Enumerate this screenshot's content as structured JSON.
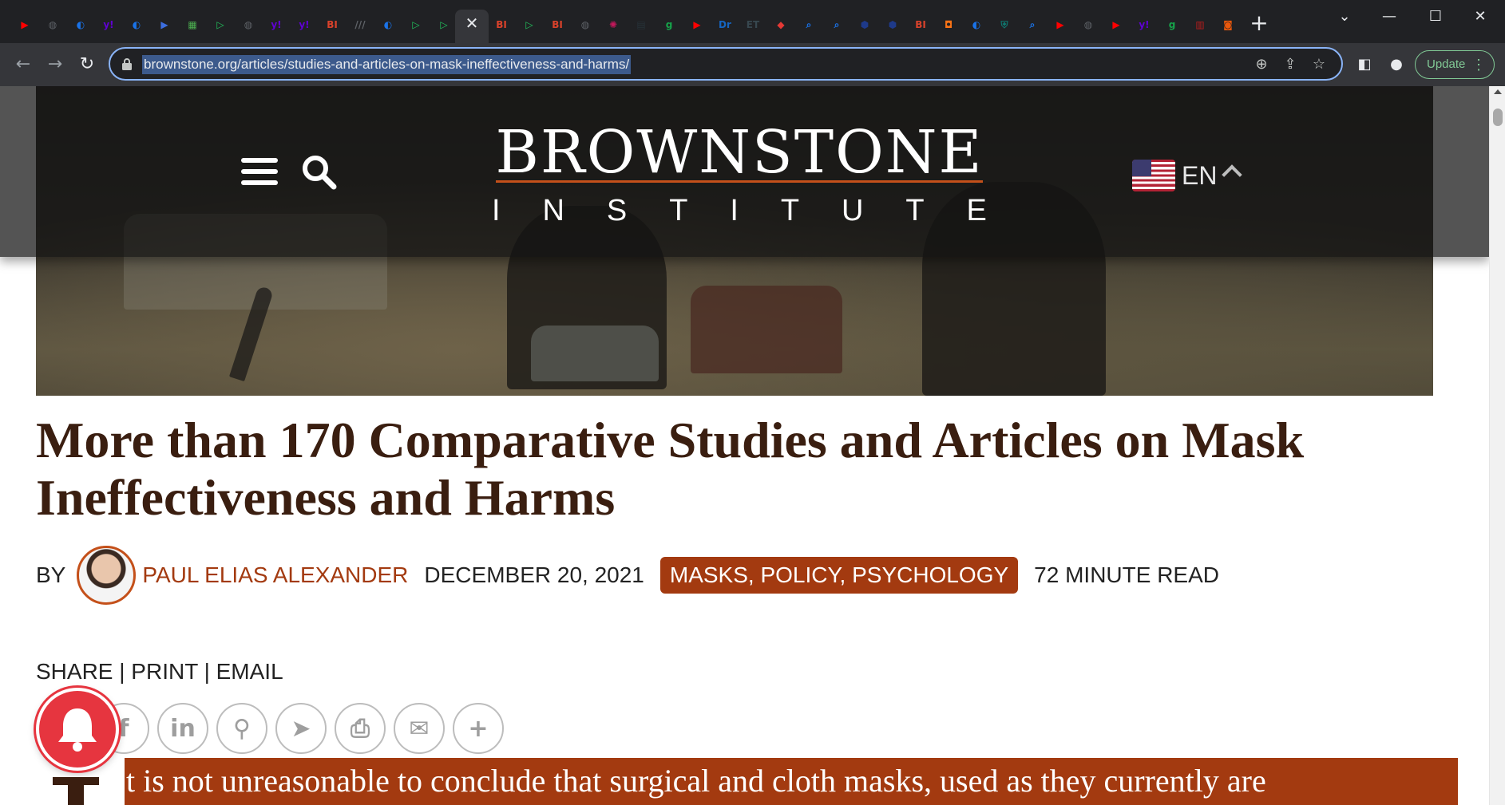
{
  "browser": {
    "url": "brownstone.org/articles/studies-and-articles-on-mask-ineffectiveness-and-harms/",
    "update_label": "Update",
    "tab_close_glyph": "✕",
    "new_tab_glyph": "+",
    "tab_icons": [
      {
        "glyph": "▶",
        "color": "#ff0000"
      },
      {
        "glyph": "◍",
        "color": "#5f6368"
      },
      {
        "glyph": "◐",
        "color": "#1a73e8"
      },
      {
        "glyph": "y!",
        "color": "#6001d2"
      },
      {
        "glyph": "◐",
        "color": "#1a73e8"
      },
      {
        "glyph": "▶",
        "color": "#3c6ee0"
      },
      {
        "glyph": "▦",
        "color": "#4caf50"
      },
      {
        "glyph": "▷",
        "color": "#22c55e"
      },
      {
        "glyph": "◍",
        "color": "#5f6368"
      },
      {
        "glyph": "y!",
        "color": "#6001d2"
      },
      {
        "glyph": "y!",
        "color": "#6001d2"
      },
      {
        "glyph": "BI",
        "color": "#d9422b"
      },
      {
        "glyph": "///",
        "color": "#5f6368"
      },
      {
        "glyph": "◐",
        "color": "#1a73e8"
      },
      {
        "glyph": "▷",
        "color": "#22c55e"
      },
      {
        "glyph": "▷",
        "color": "#22c55e"
      }
    ],
    "tab_icons_right": [
      {
        "glyph": "BI",
        "color": "#d9422b"
      },
      {
        "glyph": "▷",
        "color": "#22c55e"
      },
      {
        "glyph": "BI",
        "color": "#d9422b"
      },
      {
        "glyph": "◍",
        "color": "#5f6368"
      },
      {
        "glyph": "✺",
        "color": "#c2185b"
      },
      {
        "glyph": "▤",
        "color": "#263238"
      },
      {
        "glyph": "g",
        "color": "#16a34a"
      },
      {
        "glyph": "▶",
        "color": "#ff0000"
      },
      {
        "glyph": "Dr",
        "color": "#1565c0"
      },
      {
        "glyph": "ET",
        "color": "#37474f"
      },
      {
        "glyph": "◆",
        "color": "#e53935"
      },
      {
        "glyph": "⌕",
        "color": "#1a73e8"
      },
      {
        "glyph": "⌕",
        "color": "#1a73e8"
      },
      {
        "glyph": "⬢",
        "color": "#1e3a8a"
      },
      {
        "glyph": "⬢",
        "color": "#1e3a8a"
      },
      {
        "glyph": "BI",
        "color": "#d9422b"
      },
      {
        "glyph": "◘",
        "color": "#f97316"
      },
      {
        "glyph": "◐",
        "color": "#1a73e8"
      },
      {
        "glyph": "⛨",
        "color": "#0f766e"
      },
      {
        "glyph": "⌕",
        "color": "#1a73e8"
      },
      {
        "glyph": "▶",
        "color": "#ff0000"
      },
      {
        "glyph": "◍",
        "color": "#5f6368"
      },
      {
        "glyph": "▶",
        "color": "#ff0000"
      },
      {
        "glyph": "y!",
        "color": "#6001d2"
      },
      {
        "glyph": "g",
        "color": "#16a34a"
      },
      {
        "glyph": "▥",
        "color": "#b91c1c"
      },
      {
        "glyph": "◙",
        "color": "#ea580c"
      }
    ]
  },
  "site": {
    "logo_main": "BROWNSTONE",
    "logo_sub_letters": [
      "I",
      "N",
      "S",
      "T",
      "I",
      "T",
      "U",
      "T",
      "E"
    ],
    "language": "EN",
    "accent": "#a33a10"
  },
  "article": {
    "title": "More than 170 Comparative Studies and Articles on Mask Ineffectiveness and Harms",
    "by": "BY",
    "author": "PAUL ELIAS ALEXANDER",
    "date": "DECEMBER 20, 2021",
    "tags": "MASKS, POLICY, PSYCHOLOGY",
    "read_time": "72 MINUTE READ",
    "share_line": "SHARE | PRINT | EMAIL",
    "share_icons": [
      {
        "name": "facebook-icon",
        "glyph": "f"
      },
      {
        "name": "linkedin-icon",
        "glyph": "in"
      },
      {
        "name": "gettr-icon",
        "glyph": "⚲"
      },
      {
        "name": "telegram-icon",
        "glyph": "➤"
      },
      {
        "name": "print-icon",
        "glyph": "⎙"
      },
      {
        "name": "email-icon",
        "glyph": "✉"
      },
      {
        "name": "more-share-icon",
        "glyph": "+"
      }
    ],
    "lead_text": "t is not unreasonable to conclude that surgical and cloth masks, used as they currently are"
  }
}
